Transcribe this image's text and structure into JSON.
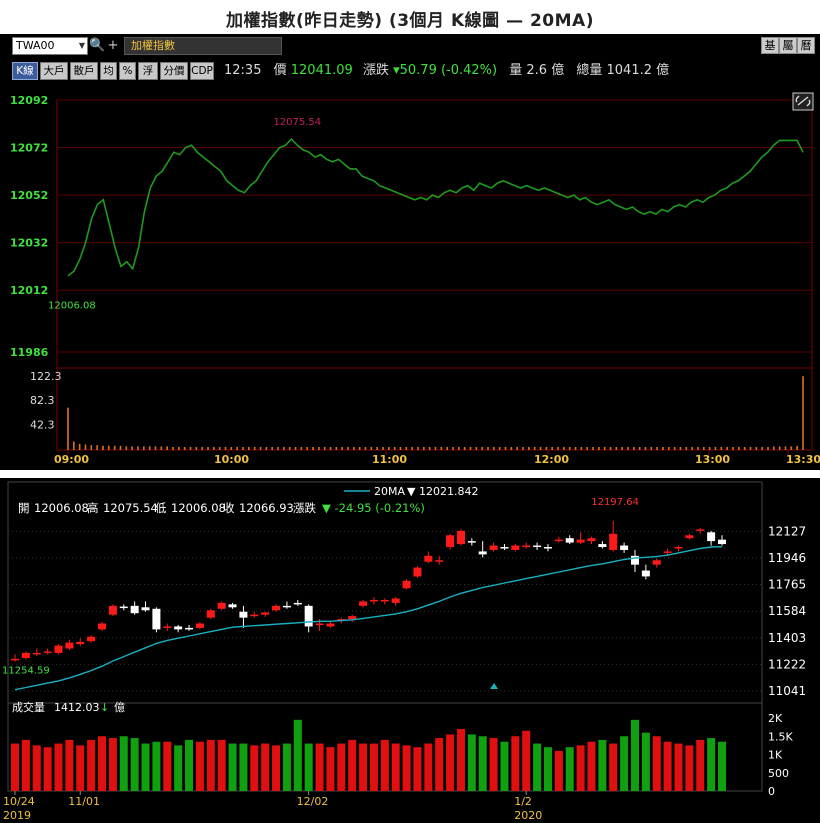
{
  "title": "加權指數(昨日走勢) (3個月 K線圖 — 20MA)",
  "toolbar": {
    "symbol": "TWA00",
    "name": "加權指數",
    "right_tabs": [
      "基",
      "屬",
      "曆"
    ],
    "buttons": [
      "K線",
      "大戶",
      "散戶",
      "均",
      "%",
      "浮",
      "分價",
      "CDP"
    ],
    "time": "12:35",
    "price_label": "價",
    "price": "12041.09",
    "change_label": "漲跌",
    "change": "▾50.79 (-0.42%)",
    "vol_label": "量",
    "vol": "2.6 億",
    "total_label": "總量",
    "total": "1041.2 億"
  },
  "colors": {
    "line": "#1f9a1f",
    "up": "#ff1a1a",
    "down": "#ffffff",
    "ma": "#1ab0c0",
    "vol_up": "#e01010",
    "vol_down": "#10a010",
    "grid": "#5a0000",
    "axis_text": "#40e040"
  },
  "chart_data": [
    {
      "type": "line",
      "panel": "intraday",
      "ylim": [
        11986,
        12092
      ],
      "yticks": [
        "12092",
        "12072",
        "12052",
        "12032",
        "12012",
        "11986"
      ],
      "xticks": [
        "09:00",
        "10:00",
        "11:00",
        "12:00",
        "13:00",
        "13:30"
      ],
      "high_label": "12075.54",
      "low_label": "12006.08",
      "series": [
        {
          "values": [
            12018,
            12020,
            12025,
            12032,
            12042,
            12048,
            12050,
            12040,
            12030,
            12022,
            12024,
            12021,
            12030,
            12045,
            12055,
            12060,
            12062,
            12066,
            12070,
            12069,
            12072,
            12073,
            12070,
            12068,
            12066,
            12064,
            12062,
            12058,
            12056,
            12054,
            12053,
            12056,
            12058,
            12062,
            12066,
            12069,
            12072,
            12073,
            12075.54,
            12073,
            12071,
            12070,
            12068,
            12069,
            12067,
            12066,
            12067,
            12065,
            12063,
            12063,
            12060,
            12059,
            12058,
            12056,
            12055,
            12054,
            12053,
            12052,
            12051,
            12050,
            12051,
            12050,
            12052,
            12051,
            12053,
            12054,
            12053,
            12055,
            12056,
            12054,
            12057,
            12056,
            12055,
            12057,
            12058,
            12057,
            12056,
            12055,
            12056,
            12055,
            12054,
            12055,
            12054,
            12053,
            12052,
            12051,
            12052,
            12050,
            12051,
            12049,
            12048,
            12049,
            12050,
            12048,
            12047,
            12046,
            12047,
            12045,
            12044,
            12045,
            12044,
            12046,
            12045,
            12047,
            12048,
            12047,
            12049,
            12050,
            12049,
            12051,
            12052,
            12054,
            12055,
            12057,
            12058,
            12060,
            12062,
            12065,
            12068,
            12070,
            12073,
            12075,
            12075,
            12075,
            12075,
            12070
          ]
        }
      ],
      "volume": {
        "ylim": [
          0,
          122.3
        ],
        "yticks": [
          "122.3",
          "82.3",
          "42.3"
        ],
        "values": [
          70,
          14,
          10,
          9,
          8,
          8,
          7,
          7,
          7,
          7,
          6,
          6,
          6,
          6,
          6,
          6,
          6,
          6,
          5,
          5,
          5,
          5,
          5,
          5,
          5,
          5,
          5,
          5,
          5,
          5,
          5,
          5,
          5,
          5,
          5,
          5,
          5,
          5,
          5,
          5,
          5,
          5,
          5,
          5,
          5,
          5,
          5,
          5,
          5,
          5,
          5,
          5,
          5,
          5,
          5,
          5,
          5,
          5,
          5,
          5,
          5,
          5,
          5,
          5,
          5,
          5,
          5,
          5,
          5,
          5,
          5,
          5,
          5,
          5,
          5,
          5,
          5,
          5,
          5,
          5,
          5,
          5,
          5,
          5,
          5,
          5,
          5,
          5,
          5,
          5,
          5,
          5,
          5,
          5,
          5,
          5,
          5,
          5,
          5,
          5,
          5,
          5,
          5,
          5,
          5,
          5,
          5,
          5,
          5,
          5,
          5,
          5,
          5,
          5,
          5,
          5,
          5,
          5,
          5,
          5,
          5,
          6,
          6,
          6,
          6,
          7,
          122
        ]
      }
    },
    {
      "type": "candlestick",
      "panel": "daily",
      "ma_label": "20MA",
      "ma_value": "▼ 12021.842",
      "ohlc_text": {
        "open_label": "開",
        "open": "12006.08",
        "high_label": "高",
        "high": "12075.54",
        "low_label": "低",
        "low": "12006.08",
        "close_label": "收",
        "close": "12066.93",
        "chg_label": "漲跌",
        "chg": "▼ -24.95 (-0.21%)"
      },
      "ylim": [
        10980,
        12190
      ],
      "yticks": [
        "12127",
        "11946",
        "11765",
        "11584",
        "11403",
        "11222",
        "11041"
      ],
      "high_label": "12197.64",
      "low_label": "11254.59",
      "xticks": [
        "10/24",
        "11/01",
        "12/02",
        "1/2"
      ],
      "xyears": [
        "2019",
        "2020"
      ],
      "candles": [
        [
          11250,
          11290,
          11240,
          11260
        ],
        [
          11265,
          11310,
          11255,
          11300
        ],
        [
          11290,
          11330,
          11280,
          11300
        ],
        [
          11305,
          11330,
          11290,
          11310
        ],
        [
          11300,
          11360,
          11290,
          11350
        ],
        [
          11330,
          11390,
          11320,
          11370
        ],
        [
          11360,
          11400,
          11345,
          11375
        ],
        [
          11380,
          11420,
          11370,
          11410
        ],
        [
          11460,
          11510,
          11450,
          11500
        ],
        [
          11560,
          11630,
          11550,
          11620
        ],
        [
          11615,
          11630,
          11590,
          11610
        ],
        [
          11620,
          11650,
          11560,
          11570
        ],
        [
          11610,
          11650,
          11580,
          11590
        ],
        [
          11600,
          11610,
          11440,
          11460
        ],
        [
          11480,
          11500,
          11450,
          11480
        ],
        [
          11480,
          11490,
          11440,
          11460
        ],
        [
          11470,
          11490,
          11450,
          11465
        ],
        [
          11470,
          11510,
          11460,
          11500
        ],
        [
          11540,
          11600,
          11530,
          11590
        ],
        [
          11600,
          11650,
          11590,
          11640
        ],
        [
          11630,
          11640,
          11600,
          11610
        ],
        [
          11580,
          11620,
          11470,
          11540
        ],
        [
          11555,
          11580,
          11540,
          11560
        ],
        [
          11560,
          11580,
          11545,
          11575
        ],
        [
          11590,
          11630,
          11580,
          11620
        ],
        [
          11620,
          11650,
          11600,
          11610
        ],
        [
          11640,
          11660,
          11620,
          11630
        ],
        [
          11620,
          11630,
          11440,
          11480
        ],
        [
          11500,
          11530,
          11450,
          11500
        ],
        [
          11480,
          11510,
          11470,
          11500
        ],
        [
          11520,
          11540,
          11500,
          11530
        ],
        [
          11530,
          11560,
          11510,
          11550
        ],
        [
          11620,
          11660,
          11610,
          11650
        ],
        [
          11660,
          11680,
          11630,
          11660
        ],
        [
          11650,
          11670,
          11630,
          11660
        ],
        [
          11640,
          11680,
          11620,
          11670
        ],
        [
          11740,
          11800,
          11730,
          11790
        ],
        [
          11820,
          11890,
          11810,
          11880
        ],
        [
          11920,
          11990,
          11910,
          11960
        ],
        [
          11920,
          11960,
          11900,
          11930
        ],
        [
          12020,
          12110,
          12000,
          12100
        ],
        [
          12040,
          12140,
          12030,
          12130
        ],
        [
          12060,
          12080,
          12030,
          12050
        ],
        [
          11990,
          12060,
          11950,
          11970
        ],
        [
          12000,
          12050,
          11990,
          12030
        ],
        [
          12020,
          12040,
          12000,
          12010
        ],
        [
          12000,
          12040,
          11990,
          12030
        ],
        [
          12030,
          12050,
          12010,
          12030
        ],
        [
          12030,
          12050,
          12000,
          12020
        ],
        [
          12020,
          12040,
          11990,
          12010
        ],
        [
          12060,
          12090,
          12050,
          12070
        ],
        [
          12080,
          12100,
          12040,
          12050
        ],
        [
          12050,
          12120,
          12040,
          12070
        ],
        [
          12060,
          12090,
          12040,
          12080
        ],
        [
          12040,
          12060,
          12010,
          12020
        ],
        [
          12000,
          12197.64,
          11990,
          12110
        ],
        [
          12030,
          12050,
          11980,
          12000
        ],
        [
          11960,
          12000,
          11850,
          11900
        ],
        [
          11860,
          11900,
          11800,
          11820
        ],
        [
          11900,
          11940,
          11880,
          11930
        ],
        [
          11980,
          12010,
          11960,
          11990
        ],
        [
          12010,
          12030,
          11990,
          12020
        ],
        [
          12080,
          12110,
          12070,
          12100
        ],
        [
          12130,
          12150,
          12110,
          12140
        ],
        [
          12120,
          12130,
          12030,
          12060
        ],
        [
          12070,
          12100,
          12030,
          12040
        ]
      ],
      "ma": [
        11050,
        11065,
        11080,
        11095,
        11110,
        11130,
        11155,
        11180,
        11210,
        11245,
        11275,
        11305,
        11335,
        11365,
        11385,
        11400,
        11415,
        11430,
        11445,
        11460,
        11475,
        11480,
        11485,
        11490,
        11495,
        11500,
        11505,
        11510,
        11515,
        11515,
        11520,
        11525,
        11535,
        11545,
        11555,
        11565,
        11580,
        11600,
        11625,
        11650,
        11680,
        11705,
        11725,
        11745,
        11760,
        11775,
        11790,
        11805,
        11820,
        11835,
        11850,
        11865,
        11880,
        11895,
        11905,
        11920,
        11935,
        11945,
        11950,
        11955,
        11965,
        11980,
        11995,
        12010,
        12020,
        12021.842
      ],
      "volume": {
        "yticks": [
          "2K",
          "1.5K",
          "1K",
          "500",
          "0"
        ],
        "ylim": [
          0,
          2000
        ],
        "label": "成交量",
        "value": "1412.03",
        "unit": "億",
        "values": [
          1300,
          1400,
          1250,
          1200,
          1300,
          1400,
          1250,
          1400,
          1500,
          1450,
          1500,
          1450,
          1300,
          1350,
          1350,
          1250,
          1400,
          1350,
          1400,
          1400,
          1300,
          1300,
          1250,
          1300,
          1250,
          1300,
          1950,
          1300,
          1300,
          1200,
          1300,
          1400,
          1300,
          1300,
          1400,
          1300,
          1250,
          1200,
          1300,
          1450,
          1550,
          1700,
          1550,
          1500,
          1450,
          1350,
          1500,
          1650,
          1300,
          1200,
          1100,
          1200,
          1250,
          1350,
          1400,
          1300,
          1500,
          1950,
          1600,
          1500,
          1350,
          1300,
          1250,
          1400,
          1450,
          1350
        ]
      }
    }
  ]
}
